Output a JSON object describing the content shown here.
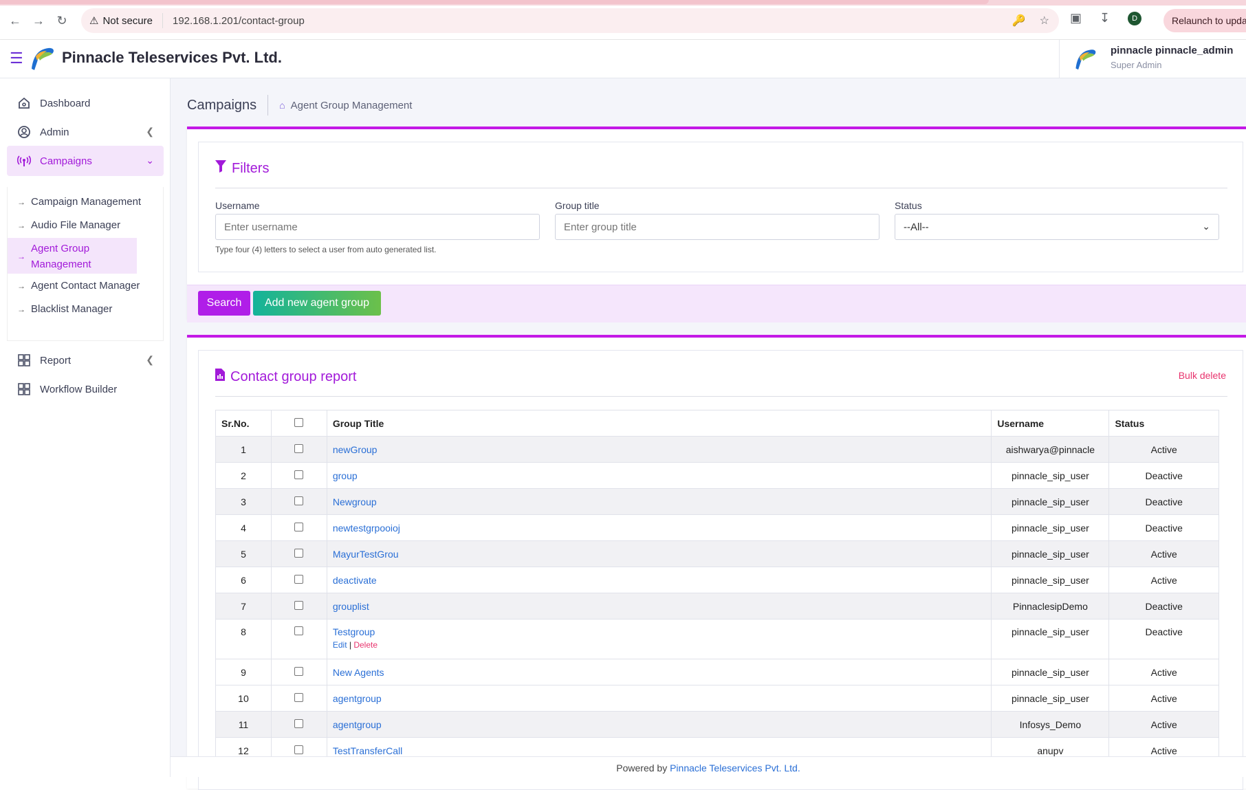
{
  "browser": {
    "security_label": "Not secure",
    "url": "192.168.1.201/contact-group",
    "profile_initial": "D",
    "relaunch_label": "Relaunch to update"
  },
  "header": {
    "brand": "Pinnacle Teleservices Pvt. Ltd.",
    "user_name": "pinnacle pinnacle_admin",
    "user_role": "Super Admin"
  },
  "sidebar": {
    "items": [
      {
        "label": "Dashboard",
        "icon": "home-icon"
      },
      {
        "label": "Admin",
        "icon": "user-circle-icon"
      },
      {
        "label": "Campaigns",
        "icon": "broadcast-icon"
      },
      {
        "label": "Report",
        "icon": "grid-icon"
      },
      {
        "label": "Workflow Builder",
        "icon": "grid-icon"
      }
    ],
    "campaign_sub": [
      {
        "label": "Campaign Management"
      },
      {
        "label": "Audio File Manager"
      },
      {
        "label": "Agent Group Management"
      },
      {
        "label": "Agent Contact Manager"
      },
      {
        "label": "Blacklist Manager"
      }
    ]
  },
  "page": {
    "title": "Campaigns",
    "breadcrumb": "Agent Group Management"
  },
  "filters": {
    "title": "Filters",
    "username_label": "Username",
    "username_placeholder": "Enter username",
    "group_label": "Group title",
    "group_placeholder": "Enter group title",
    "status_label": "Status",
    "status_value": "--All--",
    "hint": "Type four (4) letters to select a user from auto generated list.",
    "search_btn": "Search",
    "add_btn": "Add new agent group"
  },
  "report": {
    "title": "Contact group report",
    "bulk_delete": "Bulk delete",
    "columns": {
      "srno": "Sr.No.",
      "group": "Group Title",
      "username": "Username",
      "status": "Status"
    },
    "edit_label": "Edit",
    "sep": "|",
    "delete_label": "Delete",
    "rows": [
      {
        "sr": "1",
        "group": "newGroup",
        "username": "aishwarya@pinnacle",
        "status": "Active"
      },
      {
        "sr": "2",
        "group": "group",
        "username": "pinnacle_sip_user",
        "status": "Deactive"
      },
      {
        "sr": "3",
        "group": "Newgroup",
        "username": "pinnacle_sip_user",
        "status": "Deactive"
      },
      {
        "sr": "4",
        "group": "newtestgrpooioj",
        "username": "pinnacle_sip_user",
        "status": "Deactive"
      },
      {
        "sr": "5",
        "group": "MayurTestGrou",
        "username": "pinnacle_sip_user",
        "status": "Active"
      },
      {
        "sr": "6",
        "group": "deactivate",
        "username": "pinnacle_sip_user",
        "status": "Active"
      },
      {
        "sr": "7",
        "group": "grouplist",
        "username": "PinnaclesipDemo",
        "status": "Deactive"
      },
      {
        "sr": "8",
        "group": "Testgroup",
        "username": "pinnacle_sip_user",
        "status": "Deactive"
      },
      {
        "sr": "9",
        "group": "New Agents",
        "username": "pinnacle_sip_user",
        "status": "Active"
      },
      {
        "sr": "10",
        "group": "agentgroup",
        "username": "pinnacle_sip_user",
        "status": "Active"
      },
      {
        "sr": "11",
        "group": "agentgroup",
        "username": "Infosys_Demo",
        "status": "Active"
      },
      {
        "sr": "12",
        "group": "TestTransferCall",
        "username": "anupv",
        "status": "Active"
      }
    ]
  },
  "footer": {
    "prefix": "Powered by",
    "company": "Pinnacle Teleservices Pvt. Ltd."
  }
}
